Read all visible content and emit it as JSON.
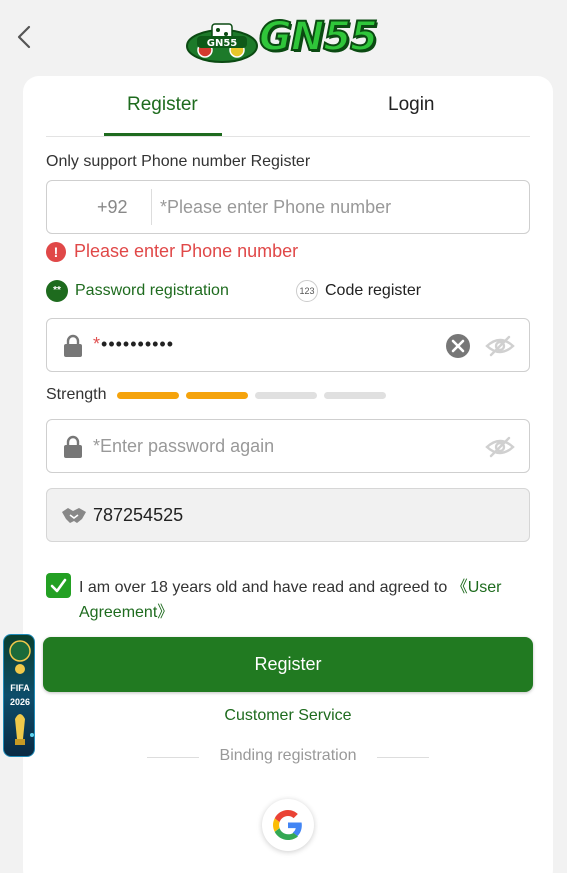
{
  "header": {
    "back_icon": "chevron-left-icon",
    "logo_text": "GN55",
    "logo_badge_text": "GN55"
  },
  "tabs": [
    {
      "label": "Register",
      "active": true
    },
    {
      "label": "Login",
      "active": false
    }
  ],
  "form": {
    "support_text": "Only support Phone number Register",
    "phone": {
      "country_code": "+92",
      "required_mark": "*",
      "placeholder": "Please enter Phone number",
      "value": ""
    },
    "error": {
      "icon": "!",
      "text": "Please enter Phone number"
    },
    "modes": {
      "password": {
        "icon": "**",
        "label": "Password registration",
        "selected": true
      },
      "code": {
        "icon": "123",
        "label": "Code register",
        "selected": false
      }
    },
    "password": {
      "required_mark": "*",
      "value": "••••••••••"
    },
    "strength": {
      "label": "Strength",
      "level": 2,
      "max": 4
    },
    "confirm_password": {
      "required_mark": "*",
      "placeholder": "Enter password again"
    },
    "invite_code": {
      "value": "787254525"
    },
    "agreement": {
      "checked": true,
      "text": "I am over 18 years old and have read and agreed to",
      "link": "《User Agreement》"
    },
    "submit_label": "Register"
  },
  "links": {
    "customer_service": "Customer Service",
    "binding_registration": "Binding registration"
  },
  "social": {
    "google_icon": "google-icon"
  },
  "promo": {
    "text": "FIFA",
    "year": "2026"
  },
  "colors": {
    "brand_green": "#217a21",
    "error_red": "#e04848",
    "strength_orange": "#f5a30c"
  }
}
